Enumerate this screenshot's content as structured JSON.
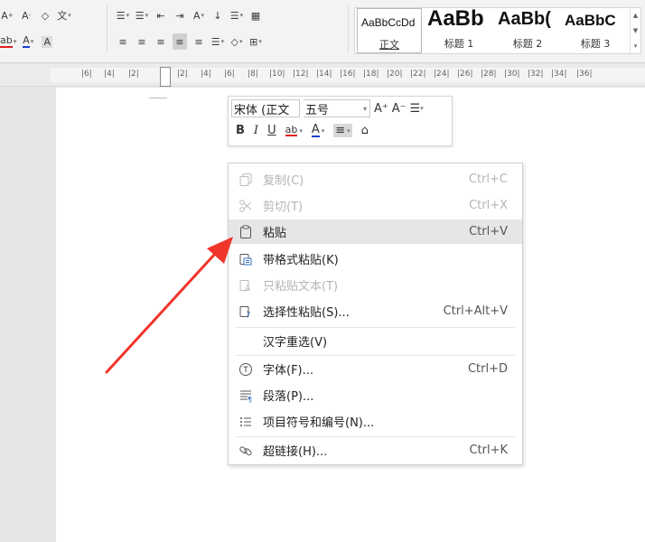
{
  "ribbon": {
    "row1": {
      "grow_font": "A",
      "shrink_font": "A",
      "clear_format": "◇",
      "phonetic": "文",
      "bullets": "☰",
      "numbering": "☰",
      "decrease_indent": "⇤",
      "increase_indent": "⇥",
      "char_scale": "A",
      "sort": "↓",
      "spacing": "☰",
      "border": "▦"
    },
    "row2": {
      "highlight": "ab",
      "font_color": "A",
      "char_shading": "A",
      "align_left": "≡",
      "align_center": "≡",
      "align_right": "≡",
      "justify": "≡",
      "distributed": "≡",
      "line_spacing": "☰",
      "shading": "◇",
      "border": "⊞"
    },
    "styles": [
      {
        "preview": "AaBbCcDd",
        "name": "正文"
      },
      {
        "preview": "AaBb",
        "name": "标题 1"
      },
      {
        "preview": "AaBb(",
        "name": "标题 2"
      },
      {
        "preview": "AaBbC",
        "name": "标题 3"
      }
    ]
  },
  "ruler": {
    "ticks": [
      "|6|",
      "|4|",
      "|2|",
      "|2|",
      "|4|",
      "|6|",
      "|8|",
      "|10|",
      "|12|",
      "|14|",
      "|16|",
      "|18|",
      "|20|",
      "|22|",
      "|24|",
      "|26|",
      "|28|",
      "|30|",
      "|32|",
      "|34|",
      "|36|"
    ]
  },
  "minibar": {
    "font_name": "宋体 (正文",
    "font_size": "五号",
    "grow": "A⁺",
    "shrink": "A⁻",
    "list": "☰",
    "bold": "B",
    "italic": "I",
    "underline": "U",
    "highlight": "ab",
    "color": "A",
    "align": "≡",
    "eraser": "⌂"
  },
  "menu": {
    "items": [
      {
        "label": "复制(C)",
        "shortcut": "Ctrl+C",
        "disabled": true
      },
      {
        "label": "剪切(T)",
        "shortcut": "Ctrl+X",
        "disabled": true
      },
      {
        "label": "粘贴",
        "shortcut": "Ctrl+V",
        "disabled": false,
        "highlighted": true
      },
      {
        "label": "带格式粘贴(K)",
        "shortcut": "",
        "disabled": false
      },
      {
        "label": "只粘贴文本(T)",
        "shortcut": "",
        "disabled": true
      },
      {
        "label": "选择性粘贴(S)...",
        "shortcut": "Ctrl+Alt+V",
        "disabled": false
      },
      {
        "label": "汉字重选(V)",
        "shortcut": "",
        "disabled": false
      },
      {
        "label": "字体(F)...",
        "shortcut": "Ctrl+D",
        "disabled": false
      },
      {
        "label": "段落(P)...",
        "shortcut": "",
        "disabled": false
      },
      {
        "label": "项目符号和编号(N)...",
        "shortcut": "",
        "disabled": false
      },
      {
        "label": "超链接(H)...",
        "shortcut": "Ctrl+K",
        "disabled": false
      }
    ]
  },
  "colors": {
    "arrow": "#f0352b",
    "highlight_red": "#e02020",
    "font_blue": "#1a3fd0"
  }
}
